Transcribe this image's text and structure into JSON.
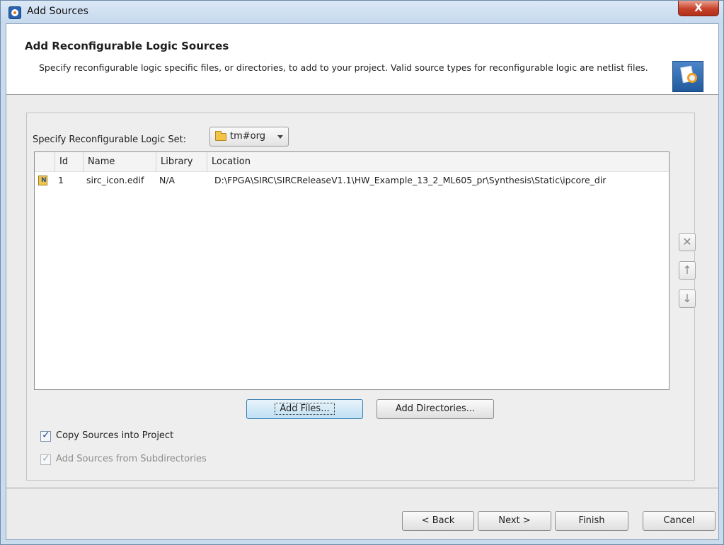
{
  "window": {
    "title": "Add Sources",
    "close_glyph": "X"
  },
  "header": {
    "title": "Add Reconfigurable Logic Sources",
    "description": "Specify reconfigurable logic specific files, or directories, to add to your project. Valid source types for reconfigurable logic are netlist files."
  },
  "logic_set": {
    "label": "Specify Reconfigurable Logic Set:",
    "value": "tm#org"
  },
  "table": {
    "columns": [
      "Id",
      "Name",
      "Library",
      "Location"
    ],
    "rows": [
      {
        "id": "1",
        "name": "sirc_icon.edif",
        "library": "N/A",
        "location": "D:\\FPGA\\SIRC\\SIRCReleaseV1.1\\HW_Example_13_2_ML605_pr\\Synthesis\\Static\\ipcore_dir"
      }
    ]
  },
  "side_buttons": {
    "remove": "✕",
    "up": "↑",
    "down": "↓"
  },
  "actions": {
    "add_files": "Add Files...",
    "add_directories": "Add Directories..."
  },
  "options": {
    "copy_sources": {
      "label": "Copy Sources into Project",
      "checked": true
    },
    "add_subdirs": {
      "label": "Add Sources from Subdirectories",
      "checked": true,
      "disabled": true
    }
  },
  "footer": {
    "back": "< Back",
    "next": "Next >",
    "finish": "Finish",
    "cancel": "Cancel"
  }
}
